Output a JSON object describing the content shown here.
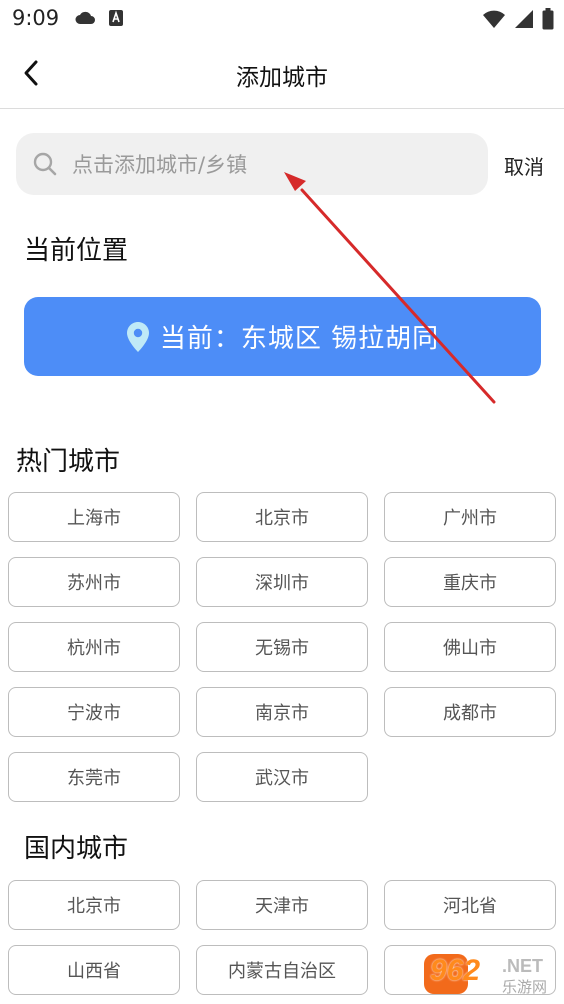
{
  "status_bar": {
    "time": "9:09"
  },
  "header": {
    "title": "添加城市"
  },
  "search": {
    "placeholder": "点击添加城市/乡镇",
    "value": "",
    "cancel_label": "取消"
  },
  "current_location": {
    "section_title": "当前位置",
    "label": "当前：东城区 锡拉胡同"
  },
  "hot_cities": {
    "section_title": "热门城市",
    "items": [
      "上海市",
      "北京市",
      "广州市",
      "苏州市",
      "深圳市",
      "重庆市",
      "杭州市",
      "无锡市",
      "佛山市",
      "宁波市",
      "南京市",
      "成都市",
      "东莞市",
      "武汉市"
    ]
  },
  "domestic_cities": {
    "section_title": "国内城市",
    "items": [
      "北京市",
      "天津市",
      "河北省",
      "山西省",
      "内蒙古自治区",
      ""
    ]
  },
  "watermark": {
    "number": "962",
    "domain": ".NET",
    "text": "乐游网"
  },
  "colors": {
    "accent": "#4d8df7",
    "annotation_arrow": "#d62a2a",
    "watermark": "#f26a1b"
  }
}
